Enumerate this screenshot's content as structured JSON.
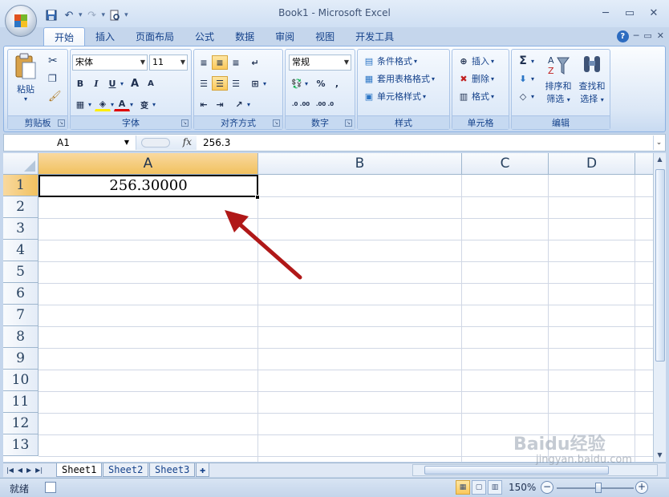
{
  "window": {
    "title": "Book1 - Microsoft Excel",
    "controls": [
      "─",
      "▭",
      "✕"
    ]
  },
  "ribbon_tabs": [
    "开始",
    "插入",
    "页面布局",
    "公式",
    "数据",
    "审阅",
    "视图",
    "开发工具"
  ],
  "ribbon": {
    "clipboard": {
      "paste": "粘贴",
      "label": "剪贴板"
    },
    "font": {
      "name": "宋体",
      "size": "11",
      "label": "字体",
      "bold": "B",
      "italic": "I",
      "underline": "U",
      "grow": "A",
      "shrink": "A",
      "wen": "变"
    },
    "alignment": {
      "label": "对齐方式"
    },
    "number": {
      "format": "常规",
      "label": "数字",
      "percent": "%",
      "comma": ",",
      "inc": ".0 .00",
      "dec": ".00 .0"
    },
    "styles": {
      "conditional": "条件格式",
      "table": "套用表格格式",
      "cell": "单元格样式",
      "label": "样式"
    },
    "cells": {
      "insert": "插入",
      "delete": "删除",
      "format": "格式",
      "label": "单元格"
    },
    "editing": {
      "sort": "排序和",
      "sort2": "筛选",
      "find": "查找和",
      "find2": "选择",
      "label": "编辑",
      "sigma": "Σ"
    }
  },
  "formula_bar": {
    "name_box": "A1",
    "fx": "fx",
    "value": "256.3"
  },
  "columns": [
    "A",
    "B",
    "C",
    "D"
  ],
  "rows": [
    "1",
    "2",
    "3",
    "4",
    "5",
    "6",
    "7",
    "8",
    "9",
    "10",
    "11",
    "12",
    "13"
  ],
  "cells": {
    "A1": "256.30000"
  },
  "sheets": [
    "Sheet1",
    "Sheet2",
    "Sheet3"
  ],
  "status": {
    "ready": "就绪",
    "zoom": "150%",
    "minus": "−",
    "plus": "+"
  },
  "watermark": {
    "main": "Baidu经验",
    "sub": "jingyan.baidu.com"
  },
  "colors": {
    "ribbon_text": "#15428b",
    "selected_header": "#f1c15f",
    "annotation_arrow": "#b01818"
  }
}
